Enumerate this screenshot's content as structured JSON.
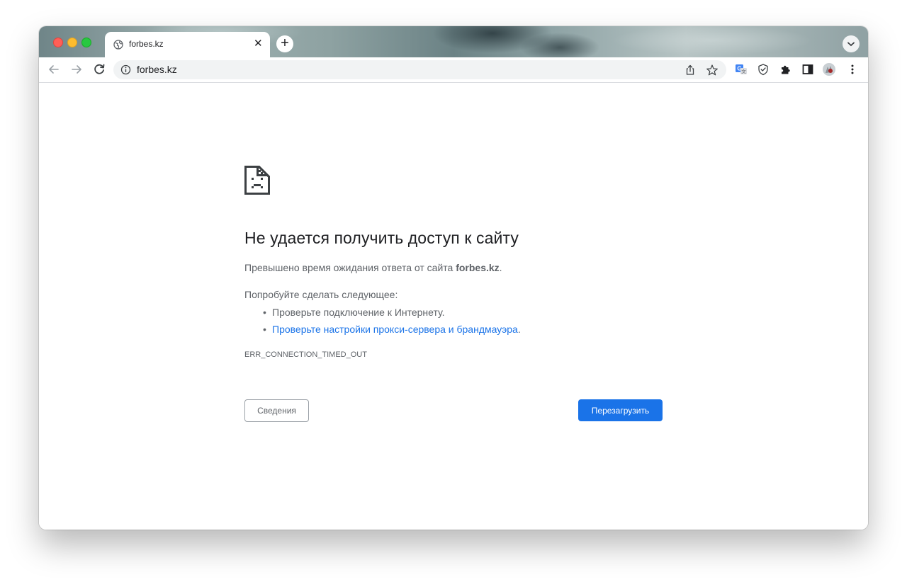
{
  "browser": {
    "tab": {
      "title": "forbes.kz",
      "close_glyph": "✕",
      "favicon": "globe-icon"
    },
    "new_tab_glyph": "+",
    "address_bar": {
      "url": "forbes.kz",
      "security_icon": "info-icon"
    },
    "toolbar_icons": [
      "back-icon",
      "forward-icon",
      "reload-icon",
      "share-icon",
      "bookmark-star-icon",
      "translate-extension-icon",
      "shield-extension-icon",
      "puzzle-extensions-icon",
      "side-panel-icon",
      "profile-avatar-icon",
      "more-menu-icon"
    ]
  },
  "error_page": {
    "heading": "Не удается получить доступ к сайту",
    "summary_prefix": "Превышено время ожидания ответа от сайта ",
    "summary_host": "forbes.kz",
    "summary_suffix": ".",
    "suggestions_title": "Попробуйте сделать следующее:",
    "suggestions": [
      {
        "text": "Проверьте подключение к Интернету.",
        "link": false
      },
      {
        "text": "Проверьте настройки прокси-сервера и брандмауэра",
        "link": true,
        "suffix": "."
      }
    ],
    "error_code": "ERR_CONNECTION_TIMED_OUT",
    "details_label": "Сведения",
    "reload_label": "Перезагрузить"
  },
  "colors": {
    "primary_button": "#1a73e8",
    "link": "#1a73e8",
    "heading_text": "#202124",
    "body_text": "#5f6368"
  }
}
